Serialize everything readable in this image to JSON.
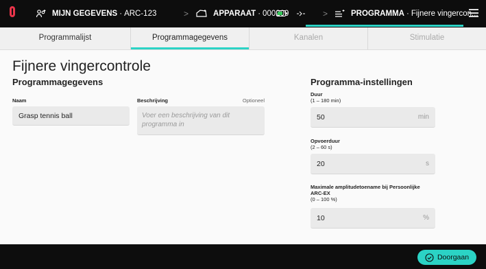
{
  "header": {
    "breadcrumbs": [
      {
        "title": "MIJN GEGEVENS",
        "detail": "ARC-123"
      },
      {
        "title": "APPARAAT",
        "detail": "000209"
      },
      {
        "title": "PROGRAMMA",
        "detail": "Fijnere vingercon..."
      }
    ],
    "separator": "·",
    "colors": {
      "accent": "#2bd3c5",
      "logo": "#e8344a",
      "battery": "#34c759"
    }
  },
  "tabs": [
    {
      "label": "Programmalijst",
      "state": "enabled"
    },
    {
      "label": "Programmagegevens",
      "state": "active"
    },
    {
      "label": "Kanalen",
      "state": "disabled"
    },
    {
      "label": "Stimulatie",
      "state": "disabled"
    }
  ],
  "page": {
    "title": "Fijnere vingercontrole"
  },
  "details": {
    "heading": "Programmagegevens",
    "name": {
      "label": "Naam",
      "value": "Grasp tennis ball"
    },
    "description": {
      "label": "Beschrijving",
      "optional": "Optioneel",
      "placeholder": "Voer een beschrijving van dit programma in"
    }
  },
  "settings": {
    "heading": "Programma-instellingen",
    "duration": {
      "label": "Duur",
      "range": "(1 – 180 min)",
      "value": "50",
      "unit": "min"
    },
    "rampup": {
      "label": "Opvoerduur",
      "range": "(2 – 60 s)",
      "value": "20",
      "unit": "s"
    },
    "amplitude": {
      "label_line1": "Maximale amplitudetoename bij Persoonlijke",
      "label_line2": "ARC-EX",
      "range": "(0 – 100 %)",
      "value": "10",
      "unit": "%"
    }
  },
  "footer": {
    "continue_label": "Doorgaan"
  }
}
